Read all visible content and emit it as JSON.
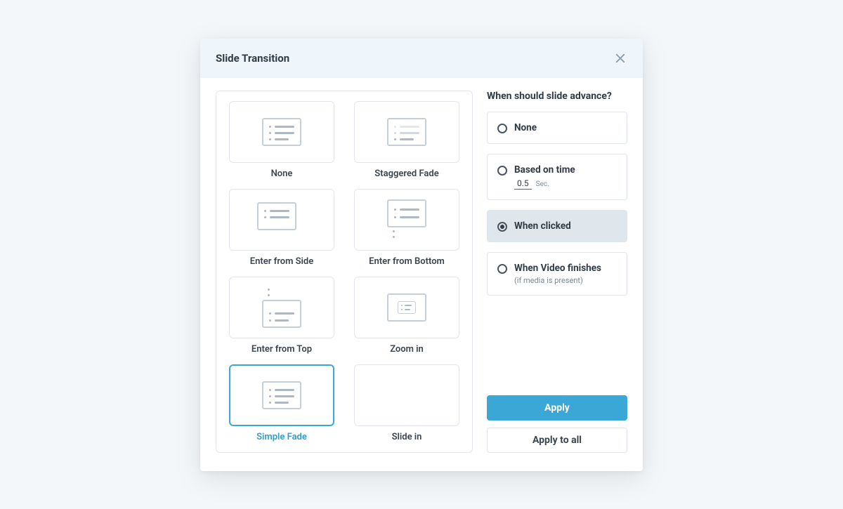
{
  "dialog": {
    "title": "Slide Transition"
  },
  "transitions": [
    {
      "id": "none",
      "label": "None",
      "selected": false
    },
    {
      "id": "staggered-fade",
      "label": "Staggered Fade",
      "selected": false
    },
    {
      "id": "enter-from-side",
      "label": "Enter from Side",
      "selected": false
    },
    {
      "id": "enter-from-bottom",
      "label": "Enter from Bottom",
      "selected": false
    },
    {
      "id": "enter-from-top",
      "label": "Enter from Top",
      "selected": false
    },
    {
      "id": "zoom-in",
      "label": "Zoom in",
      "selected": false
    },
    {
      "id": "simple-fade",
      "label": "Simple Fade",
      "selected": true
    },
    {
      "id": "slide-in",
      "label": "Slide in",
      "selected": false
    }
  ],
  "advance": {
    "title": "When should slide advance?",
    "options": {
      "none": {
        "label": "None",
        "selected": false
      },
      "based_on_time": {
        "label": "Based on time",
        "selected": false,
        "value": "0.5",
        "unit": "Sec."
      },
      "when_clicked": {
        "label": "When clicked",
        "selected": true
      },
      "video_finishes": {
        "label": "When Video finishes",
        "selected": false,
        "sub": "(if media is present)"
      }
    }
  },
  "actions": {
    "apply": "Apply",
    "apply_all": "Apply to all"
  }
}
